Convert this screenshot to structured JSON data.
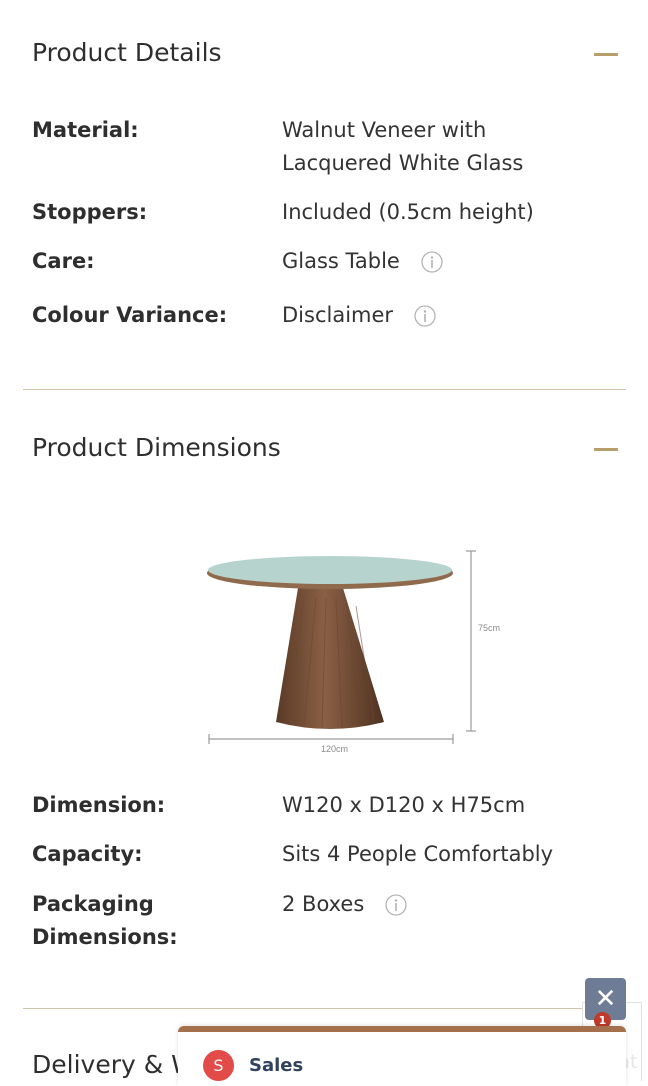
{
  "product_details": {
    "title": "Product Details",
    "rows": [
      {
        "label": "Material:",
        "value_line1": "Walnut Veneer with",
        "value_line2": "Lacquered White Glass"
      },
      {
        "label": "Stoppers:",
        "value": "Included (0.5cm height)"
      },
      {
        "label": "Care:",
        "value": "Glass Table"
      },
      {
        "label": "Colour Variance:",
        "value": "Disclaimer"
      }
    ]
  },
  "product_dimensions": {
    "title": "Product Dimensions",
    "diagram": {
      "height_label": "75cm",
      "width_label": "120cm"
    },
    "rows": [
      {
        "label": "Dimension:",
        "value": "W120 x D120 x H75cm"
      },
      {
        "label": "Capacity:",
        "value": "Sits 4 People Comfortably"
      },
      {
        "label_line1": "Packaging",
        "label_line2": "Dimensions:",
        "value": "2 Boxes"
      }
    ]
  },
  "delivery": {
    "title": "Delivery & W"
  },
  "chat": {
    "close": "✕",
    "badge": "1",
    "faded_label": "Chat",
    "avatar_initial": "S",
    "agent_label": "Sales"
  },
  "colors": {
    "accent": "#b89e6a",
    "divider": "#cfc6a7",
    "sales_bar": "#a5714c",
    "close_button": "#6e7c95",
    "avatar": "#e24b48"
  }
}
